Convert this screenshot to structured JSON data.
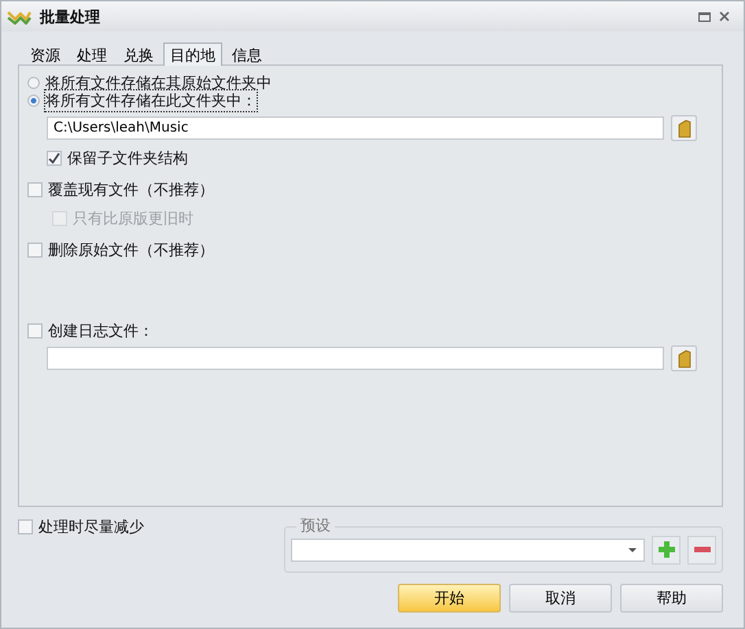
{
  "window": {
    "title": "批量处理"
  },
  "tabs": [
    {
      "label": "资源",
      "selected": false
    },
    {
      "label": "处理",
      "selected": false
    },
    {
      "label": "兑换",
      "selected": false
    },
    {
      "label": "目的地",
      "selected": true
    },
    {
      "label": "信息",
      "selected": false
    }
  ],
  "destination": {
    "options": [
      {
        "label": "将所有文件存储在其原始文件夹中",
        "selected": false
      },
      {
        "label": "将所有文件存储在此文件夹中：",
        "selected": true
      }
    ],
    "folder_path": "C:\\Users\\leah\\Music",
    "keep_structure": {
      "label": "保留子文件夹结构",
      "checked": true
    }
  },
  "overwrite": {
    "label": "覆盖现有文件（不推荐）",
    "checked": false
  },
  "only_older": {
    "label": "只有比原版更旧时",
    "checked": false,
    "disabled": true
  },
  "delete_original": {
    "label": "删除原始文件（不推荐）",
    "checked": false
  },
  "log_file": {
    "label": "创建日志文件：",
    "checked": false
  },
  "minimize": {
    "label": "处理时尽量减少",
    "checked": false
  },
  "preset": {
    "label": "预设"
  },
  "buttons": [
    {
      "label": "开始",
      "kind": "primary"
    },
    {
      "label": "取消",
      "kind": "normal"
    },
    {
      "label": "帮助",
      "kind": "normal"
    }
  ]
}
